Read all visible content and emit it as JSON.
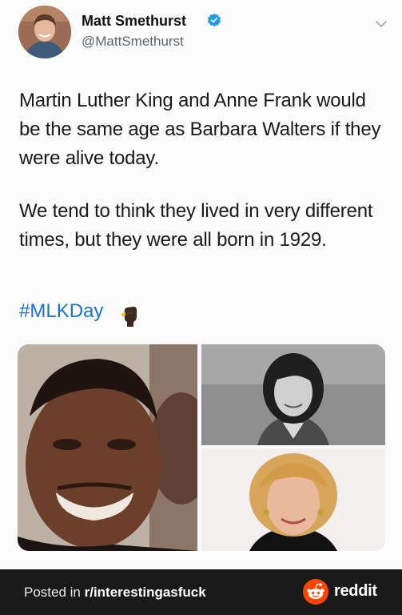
{
  "tweet": {
    "author_name": "Matt Smethurst",
    "author_handle": "@MattSmethurst",
    "paragraph_1": "Martin Luther King and Anne Frank would be the same age as Barbara Walters if they were alive today.",
    "paragraph_2": "We tend to think they lived in very different times, but they were all born in 1929.",
    "hashtag": "#MLKDay",
    "icons": [
      "verified-badge-icon",
      "chevron-down-icon",
      "raised-fist-emoji-icon"
    ],
    "media": [
      "photo-martin-luther-king",
      "photo-anne-frank",
      "photo-barbara-walters"
    ]
  },
  "footer": {
    "posted_prefix": "Posted in ",
    "subreddit": "r/interestingasfuck",
    "brand": "reddit"
  },
  "colors": {
    "hashtag": "#1d74c4",
    "verified": "#1d9bf0",
    "footer_bg": "#1a1a1b",
    "reddit_orange": "#ff4500"
  }
}
